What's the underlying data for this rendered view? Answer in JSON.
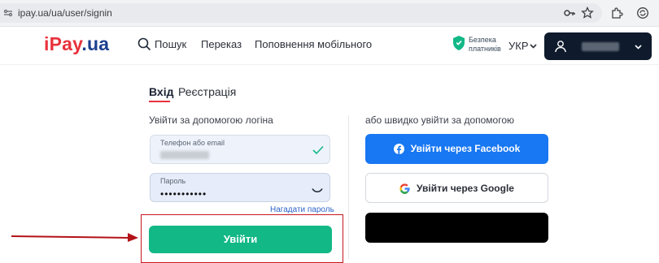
{
  "browser": {
    "url": "ipay.ua/ua/user/signin"
  },
  "header": {
    "logo_primary": "iPay",
    "logo_suffix": ".ua",
    "nav": {
      "search": "Пошук",
      "transfer": "Переказ",
      "mobile_topup": "Поповнення мобільного"
    },
    "safety_line1": "Безпека",
    "safety_line2": "платників",
    "language": "УКР"
  },
  "tabs": {
    "login": "Вхід",
    "register": "Реєстрація"
  },
  "login_form": {
    "title": "Увійти за допомогою логіна",
    "phone_label": "Телефон або email",
    "password_label": "Пароль",
    "password_value": "•••••••••••",
    "forgot_link": "Нагадати пароль",
    "submit_label": "Увійти"
  },
  "social": {
    "title": "або швидко увійти за допомогою",
    "facebook_label": "Увійти через Facebook",
    "google_label": "Увійти через Google"
  },
  "colors": {
    "brand_blue": "#1c3f8f",
    "brand_red": "#e8323c",
    "submit_green": "#12b886",
    "facebook_blue": "#1877f2"
  }
}
